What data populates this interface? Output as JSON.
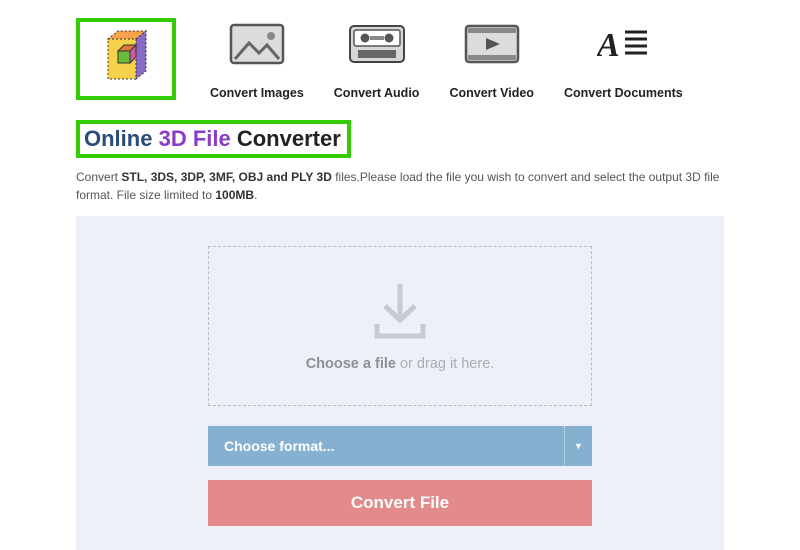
{
  "nav": {
    "items": [
      {
        "label": "Convert Images",
        "icon": "image-icon"
      },
      {
        "label": "Convert Audio",
        "icon": "audio-icon"
      },
      {
        "label": "Convert Video",
        "icon": "video-icon"
      },
      {
        "label": "Convert Documents",
        "icon": "document-icon"
      }
    ]
  },
  "title": {
    "part1": "Online",
    "part2": "3D File",
    "part3": "Converter"
  },
  "description": {
    "prefix": "Convert ",
    "formats": "STL, 3DS, 3DP, 3MF, OBJ and PLY 3D",
    "mid": " files.Please load the file you wish to convert and select the output 3D file format. File size limited to ",
    "limit": "100MB",
    "suffix": "."
  },
  "dropzone": {
    "strong": "Choose a file",
    "rest": " or drag it here."
  },
  "format_select": {
    "label": "Choose format..."
  },
  "convert_button": {
    "label": "Convert File"
  },
  "colors": {
    "highlight_border": "#33cc00",
    "panel_bg": "#edf0f7",
    "select_bg": "#86b0cf",
    "button_bg": "#e38a8a"
  }
}
